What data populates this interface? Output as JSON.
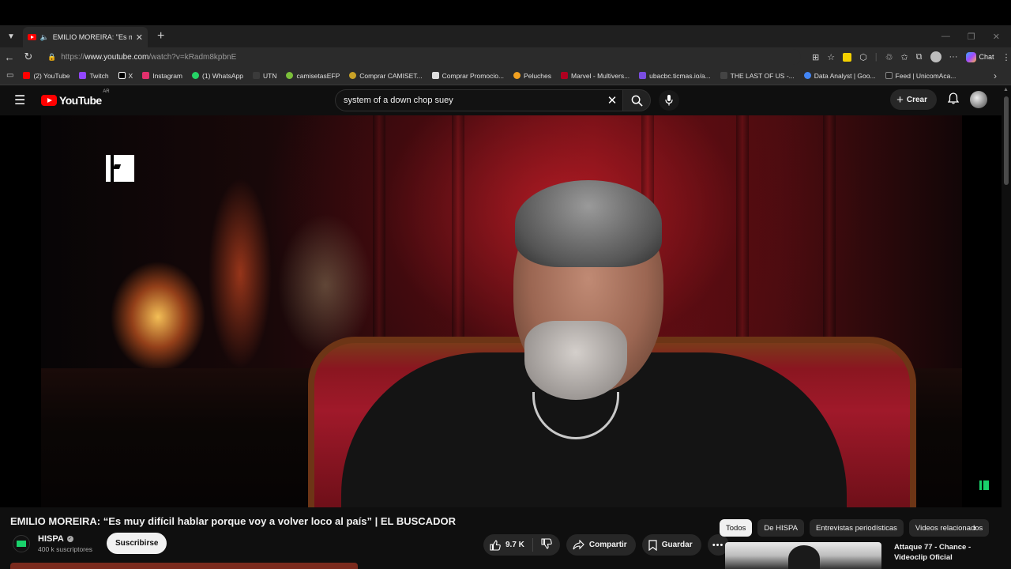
{
  "browser": {
    "tab_title": "EMILIO MOREIRA: \"Es muy difícil hablar porque voy a volver loco al país\" | EL BUSCADOR",
    "url_prefix": "https://",
    "url_host": "www.youtube.com",
    "url_path": "/watch?v=kRadm8kpbnE",
    "chat_label": "Chat",
    "bookmarks": [
      {
        "label": "(2) YouTube",
        "color": "#ff0000"
      },
      {
        "label": "Twitch",
        "color": "#9146ff"
      },
      {
        "label": "X",
        "color": "#ffffff"
      },
      {
        "label": "Instagram",
        "color": "#e1306c"
      },
      {
        "label": "(1) WhatsApp",
        "color": "#25d366"
      },
      {
        "label": "UTN",
        "color": "#3a3a3a"
      },
      {
        "label": "camisetasEFP",
        "color": "#7bbf3a"
      },
      {
        "label": "Comprar CAMISET...",
        "color": "#c9a227"
      },
      {
        "label": "Comprar Promocio...",
        "color": "#dddddd"
      },
      {
        "label": "Peluches",
        "color": "#f0a020"
      },
      {
        "label": "Marvel - Multivers...",
        "color": "#b00020"
      },
      {
        "label": "ubacbc.ticmas.io/a...",
        "color": "#7a4de0"
      },
      {
        "label": "THE LAST OF US -...",
        "color": "#444444"
      },
      {
        "label": "Data Analyst | Goo...",
        "color": "#4285f4"
      },
      {
        "label": "Feed | UnicomAca...",
        "color": "#222222"
      }
    ]
  },
  "youtube": {
    "logo_text": "YouTube",
    "region": "AR",
    "search_value": "system of a down chop suey",
    "create_label": "Crear",
    "video": {
      "title": "EMILIO MOREIRA: “Es muy difícil hablar porque voy a volver loco al país” | EL BUSCADOR",
      "channel_name": "HISPA",
      "subscribers": "400 k suscriptores",
      "subscribe_label": "Suscribirse",
      "likes": "9.7 K",
      "share_label": "Compartir",
      "save_label": "Guardar"
    },
    "chips": [
      "Todos",
      "De HISPA",
      "Entrevistas periodísticas",
      "Videos relacionados"
    ],
    "recommended": {
      "title": "Attaque 77 - Chance - Videoclip Oficial"
    }
  }
}
